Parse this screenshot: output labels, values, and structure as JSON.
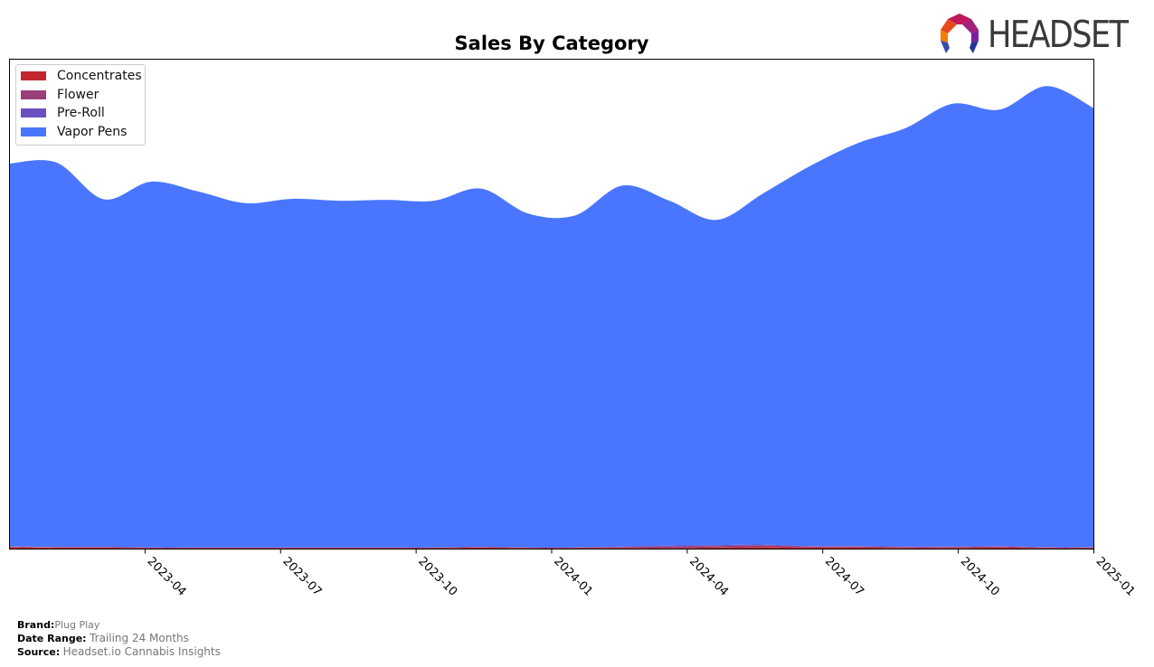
{
  "header": {
    "brand_logo_text": "HEADSET",
    "logo_icon": "headset-hexagon-logo-icon"
  },
  "footer": {
    "brand_key": "Brand:",
    "brand_value": "Plug Play",
    "date_range_key": "Date Range:",
    "date_range_value": "Trailing 24 Months",
    "source_key": "Source:",
    "source_value": "Headset.io Cannabis Insights"
  },
  "chart_data": {
    "type": "area",
    "stacked": true,
    "title": "Sales By Category",
    "xlabel": "",
    "ylabel": "",
    "y_ticks_shown": false,
    "grid": false,
    "legend_position": "top-left",
    "x": [
      "2023-01",
      "2023-02",
      "2023-03",
      "2023-04",
      "2023-05",
      "2023-06",
      "2023-07",
      "2023-08",
      "2023-09",
      "2023-10",
      "2023-11",
      "2023-12",
      "2024-01",
      "2024-02",
      "2024-03",
      "2024-04",
      "2024-05",
      "2024-06",
      "2024-07",
      "2024-08",
      "2024-09",
      "2024-10",
      "2024-11",
      "2024-12"
    ],
    "x_tick_labels": [
      "2023-04",
      "2023-07",
      "2023-10",
      "2024-01",
      "2024-04",
      "2024-07",
      "2024-10",
      "2025-01"
    ],
    "x_range": [
      "2023-01",
      "2025-01"
    ],
    "ylim": [
      0,
      100
    ],
    "series": [
      {
        "name": "Concentrates",
        "color": "#c1272d",
        "values": [
          0.4,
          0.3,
          0.3,
          0.2,
          0.2,
          0.2,
          0.2,
          0.2,
          0.2,
          0.2,
          0.3,
          0.2,
          0.2,
          0.2,
          0.2,
          0.3,
          0.4,
          0.3,
          0.3,
          0.2,
          0.2,
          0.3,
          0.2,
          0.2
        ]
      },
      {
        "name": "Flower",
        "color": "#9b3f7a",
        "values": [
          0.1,
          0.1,
          0.1,
          0.1,
          0.1,
          0.1,
          0.1,
          0.1,
          0.1,
          0.1,
          0.1,
          0.1,
          0.1,
          0.2,
          0.3,
          0.3,
          0.3,
          0.2,
          0.2,
          0.2,
          0.2,
          0.2,
          0.1,
          0.1
        ]
      },
      {
        "name": "Pre-Roll",
        "color": "#6a4fc1",
        "values": [
          0.0,
          0.0,
          0.0,
          0.0,
          0.0,
          0.0,
          0.0,
          0.0,
          0.0,
          0.0,
          0.0,
          0.0,
          0.0,
          0.1,
          0.2,
          0.2,
          0.2,
          0.1,
          0.1,
          0.1,
          0.1,
          0.1,
          0.1,
          0.0
        ]
      },
      {
        "name": "Vapor Pens",
        "color": "#4a76ff",
        "values": [
          78.2,
          78.5,
          71.0,
          74.7,
          72.7,
          70.3,
          71.2,
          70.8,
          71.0,
          70.8,
          73.2,
          68.2,
          67.8,
          73.7,
          70.4,
          66.4,
          71.8,
          77.7,
          82.3,
          85.4,
          90.4,
          89.1,
          94.1,
          89.7
        ]
      }
    ]
  }
}
